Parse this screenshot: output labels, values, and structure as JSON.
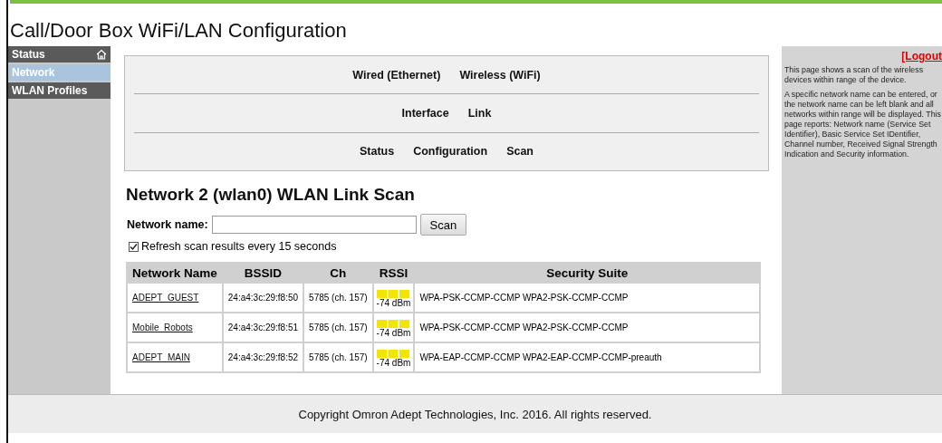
{
  "title": "Call/Door Box WiFi/LAN Configuration",
  "sidebar": {
    "items": [
      {
        "label": "Status",
        "selected": false,
        "home": true
      },
      {
        "label": "Network",
        "selected": true,
        "home": false
      },
      {
        "label": "WLAN Profiles",
        "selected": false,
        "home": false
      }
    ]
  },
  "nav": [
    [
      "Wired (Ethernet)",
      "Wireless (WiFi)"
    ],
    [
      "Interface",
      "Link"
    ],
    [
      "Status",
      "Configuration",
      "Scan"
    ]
  ],
  "heading": "Network 2 (wlan0) WLAN Link Scan",
  "network_name": {
    "label": "Network name:"
  },
  "scan_button": "Scan",
  "refresh": {
    "label": "Refresh scan results every 15 seconds",
    "checked": true
  },
  "table": {
    "columns": [
      "Network Name",
      "BSSID",
      "Ch",
      "RSSI",
      "Security Suite"
    ],
    "rows": [
      {
        "name": "ADEPT_GUEST",
        "bssid": "24:a4:3c:29:f8:50",
        "ch": "5785 (ch. 157)",
        "rssi": "-74 dBm",
        "security": "WPA-PSK-CCMP-CCMP WPA2-PSK-CCMP-CCMP"
      },
      {
        "name": "Mobile_Robots",
        "bssid": "24:a4:3c:29:f8:51",
        "ch": "5785 (ch. 157)",
        "rssi": "-74 dBm",
        "security": "WPA-PSK-CCMP-CCMP WPA2-PSK-CCMP-CCMP"
      },
      {
        "name": "ADEPT_MAIN",
        "bssid": "24:a4:3c:29:f8:52",
        "ch": "5785 (ch. 157)",
        "rssi": "-74 dBm",
        "security": "WPA-EAP-CCMP-CCMP WPA2-EAP-CCMP-CCMP-preauth"
      }
    ]
  },
  "help": {
    "logout": "[Logout",
    "paragraphs": [
      "This page shows a scan of the wireless devices within range of the device.",
      "A specific network name can be entered, or the network name can be left blank and all networks within range will be displayed. This page reports: Network name (Service Set Identifier), Basic Service Set IDentifier, Channel number, Received Signal Strength Indication and Security information."
    ]
  },
  "footer": "Copyright Omron Adept Technologies, Inc. 2016. All rights reserved."
}
